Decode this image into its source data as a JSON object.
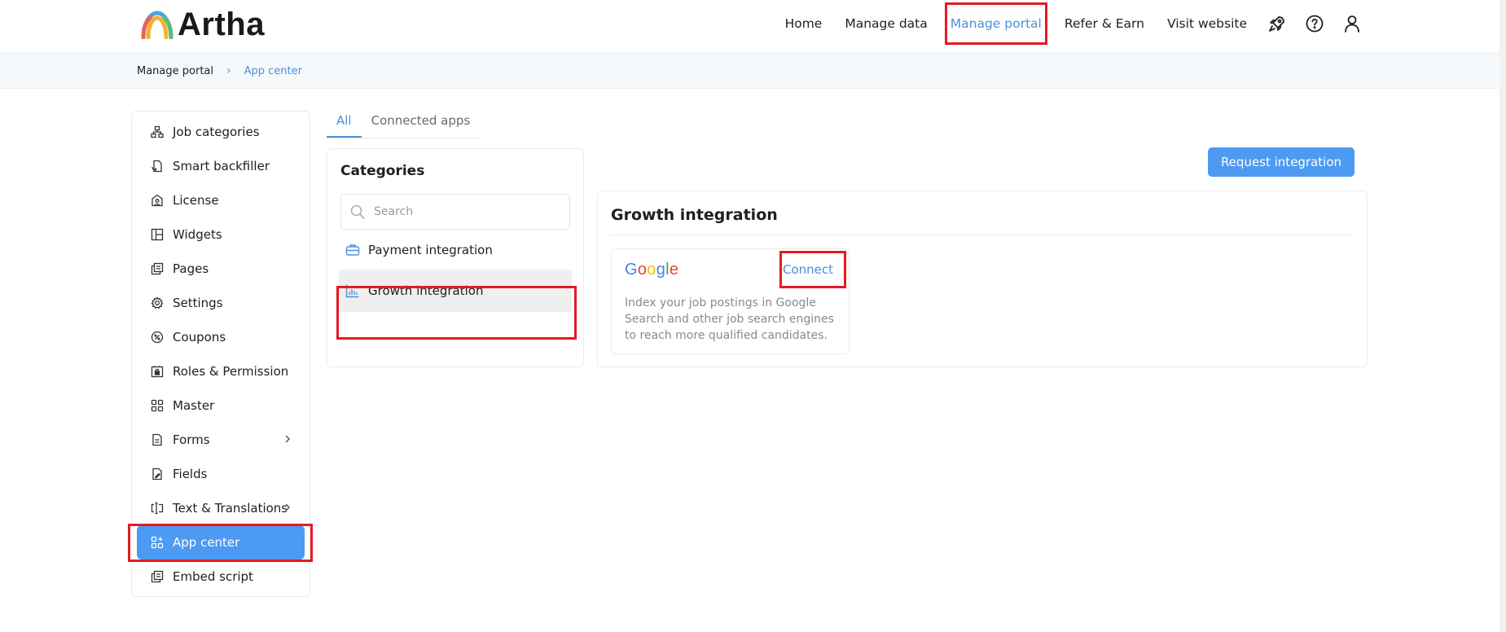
{
  "header": {
    "logo_text": "Artha",
    "nav": [
      "Home",
      "Manage data",
      "Manage portal",
      "Refer & Earn",
      "Visit website"
    ],
    "active_nav": "Manage portal",
    "icons": [
      "rocket-icon",
      "help-icon",
      "user-icon"
    ]
  },
  "breadcrumb": {
    "items": [
      "Manage portal",
      "App center"
    ]
  },
  "sidebar": {
    "items": [
      {
        "label": "Job categories",
        "icon": "sitemap-icon"
      },
      {
        "label": "Smart backfiller",
        "icon": "document-sync-icon"
      },
      {
        "label": "License",
        "icon": "license-icon"
      },
      {
        "label": "Widgets",
        "icon": "widgets-icon"
      },
      {
        "label": "Pages",
        "icon": "pages-icon"
      },
      {
        "label": "Settings",
        "icon": "gear-icon"
      },
      {
        "label": "Coupons",
        "icon": "coupon-icon"
      },
      {
        "label": "Roles & Permission",
        "icon": "roles-icon"
      },
      {
        "label": "Master",
        "icon": "grid-icon"
      },
      {
        "label": "Forms",
        "icon": "form-icon"
      },
      {
        "label": "Fields",
        "icon": "fields-icon"
      },
      {
        "label": "Text & Translations",
        "icon": "text-cursor-icon"
      },
      {
        "label": "App center",
        "icon": "apps-add-icon"
      },
      {
        "label": "Embed script",
        "icon": "embed-icon"
      }
    ],
    "active": "App center"
  },
  "tabs": {
    "all": "All",
    "connected": "Connected apps"
  },
  "categories": {
    "title": "Categories",
    "search_placeholder": "Search",
    "items": [
      "Payment integration",
      "Growth integration"
    ],
    "active": "Growth integration"
  },
  "request_button": "Request integration",
  "growth": {
    "title": "Growth integration",
    "card": {
      "logo": [
        "G",
        "o",
        "o",
        "g",
        "l",
        "e"
      ],
      "logo_colors": [
        "#4285F4",
        "#EA4335",
        "#FBBC05",
        "#4285F4",
        "#34A853",
        "#EA4335"
      ],
      "connect": "Connect",
      "description": "Index your job postings in Google Search and other job search engines to reach more qualified candidates."
    }
  },
  "colors": {
    "accent": "#4d9af2",
    "link": "#4a90d9",
    "highlight": "#e31b23"
  }
}
